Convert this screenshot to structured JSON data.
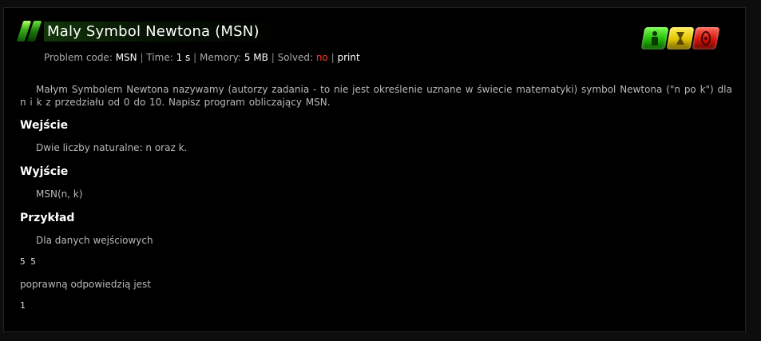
{
  "problem": {
    "title": "Maly Symbol Newtona (MSN)",
    "meta": {
      "code_label": "Problem code:",
      "code": "MSN",
      "time_label": "Time:",
      "time": "1 s",
      "memory_label": "Memory:",
      "memory": "5 MB",
      "solved_label": "Solved:",
      "solved": "no",
      "sep": "|",
      "print": "print"
    },
    "rating_icons": [
      "easy-icon",
      "medium-icon",
      "hard-icon"
    ],
    "colors": {
      "green": "#22b80a",
      "yellow": "#e2c200",
      "red": "#d21408",
      "solved_no": "#ff3b1e"
    }
  },
  "body": {
    "intro": "Małym Symbolem Newtona nazywamy (autorzy zadania - to nie jest określenie uznane w świecie matematyki) symbol Newtona (\"n po k\") dla n i k z przedziału od 0 do 10. Napisz program obliczający MSN.",
    "input_heading": "Wejście",
    "input_text": "Dwie liczby naturalne: n oraz k.",
    "output_heading": "Wyjście",
    "output_text": "MSN(n, k)",
    "example_heading": "Przykład",
    "example_intro": "Dla danych wejściowych",
    "example_input": "5 5",
    "example_answer_label": "poprawną odpowiedzią jest",
    "example_output": "1"
  }
}
